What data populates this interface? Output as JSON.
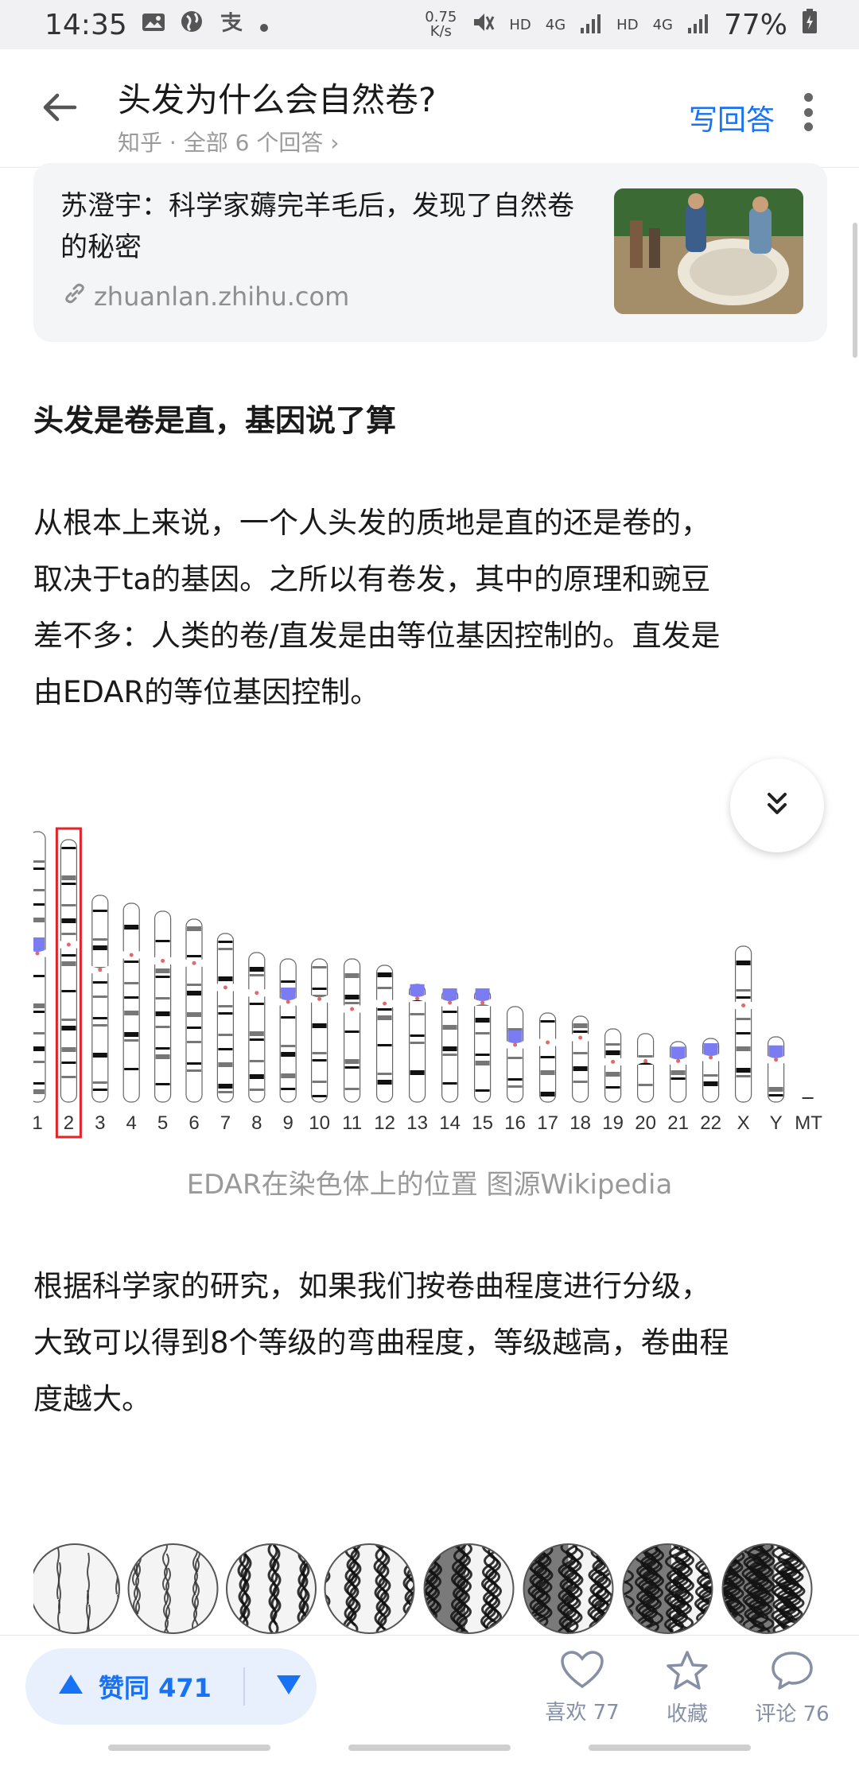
{
  "status_bar": {
    "time": "14:35",
    "net_speed_value": "0.75",
    "net_speed_unit": "K/s",
    "hd1": "HD",
    "net1": "4G",
    "hd2": "HD",
    "net2": "4G",
    "battery": "77%",
    "icons": [
      "image-icon",
      "globe-icon",
      "alipay-icon",
      "dot-icon",
      "mute-icon",
      "signal-icon",
      "battery-icon"
    ]
  },
  "header": {
    "title": "头发为什么会自然卷?",
    "subtitle": "知乎 · 全部 6 个回答 ›",
    "write_answer": "写回答"
  },
  "link_card": {
    "title": "苏澄宇：科学家薅完羊毛后，发现了自然卷的秘密",
    "domain": "zhuanlan.zhihu.com"
  },
  "article": {
    "heading": "头发是卷是直，基因说了算",
    "paragraph1_lines": [
      "从根本上来说，一个人头发的质地是直的还是卷的，",
      "取决于ta的基因。之所以有卷发，其中的原理和豌豆",
      "差不多：人类的卷/直发是由等位基因控制的。直发是",
      "由EDAR的等位基因控制。"
    ],
    "figure_caption": "EDAR在染色体上的位置 图源Wikipedia",
    "chromosome_labels": [
      "1",
      "2",
      "3",
      "4",
      "5",
      "6",
      "7",
      "8",
      "9",
      "10",
      "11",
      "12",
      "13",
      "14",
      "15",
      "16",
      "17",
      "18",
      "19",
      "20",
      "21",
      "22",
      "X",
      "Y",
      "MT"
    ],
    "highlighted_chromosome": "2",
    "paragraph2_lines": [
      "根据科学家的研究，如果我们按卷曲程度进行分级，",
      "大致可以得到8个等级的弯曲程度，等级越高，卷曲程",
      "度越大。"
    ]
  },
  "bottom_bar": {
    "upvote": "赞同 471",
    "like": "喜欢 77",
    "collect": "收藏",
    "comment": "评论 76"
  },
  "colors": {
    "accent": "#1772f6",
    "vote_bg": "#e8f0fe",
    "highlight_box": "#e0242a",
    "band_purple": "#7b7cf2"
  }
}
